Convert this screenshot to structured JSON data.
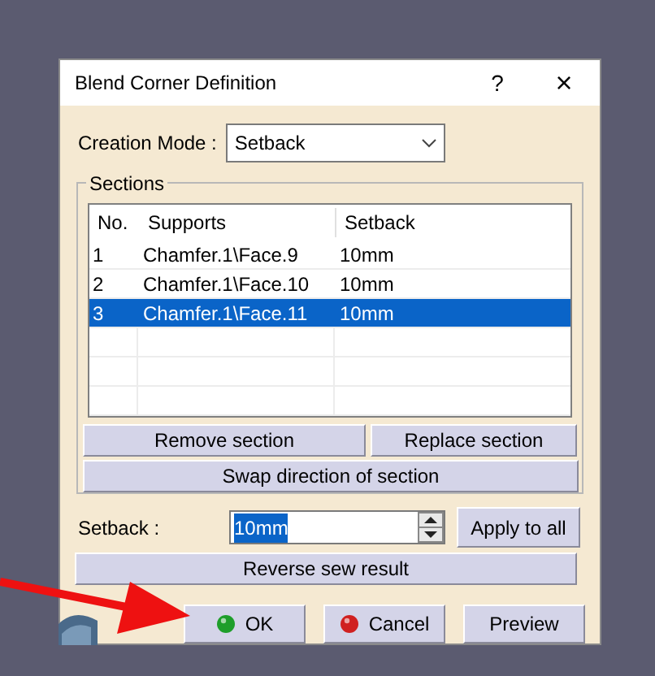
{
  "window": {
    "title": "Blend Corner Definition",
    "help": "?",
    "close": "×"
  },
  "creation_mode": {
    "label": "Creation Mode :",
    "value": "Setback"
  },
  "sections": {
    "title": "Sections",
    "columns": [
      "No.",
      "Supports",
      "Setback"
    ],
    "rows": [
      {
        "cells": [
          "1",
          "Chamfer.1\\Face.9",
          "10mm"
        ],
        "selected": false
      },
      {
        "cells": [
          "2",
          "Chamfer.1\\Face.10",
          "10mm"
        ],
        "selected": false
      },
      {
        "cells": [
          "3",
          "Chamfer.1\\Face.11",
          "10mm"
        ],
        "selected": true
      }
    ],
    "buttons": [
      "Remove section",
      "Replace section",
      "Swap direction of section"
    ]
  },
  "setback": {
    "label": "Setback :",
    "value": "10mm",
    "apply": "Apply to all"
  },
  "reverse": "Reverse sew result",
  "buttons": [
    {
      "label": "OK",
      "kind": "ok"
    },
    {
      "label": "Cancel",
      "kind": "cancel"
    },
    {
      "label": "Preview",
      "kind": "plain"
    }
  ]
}
